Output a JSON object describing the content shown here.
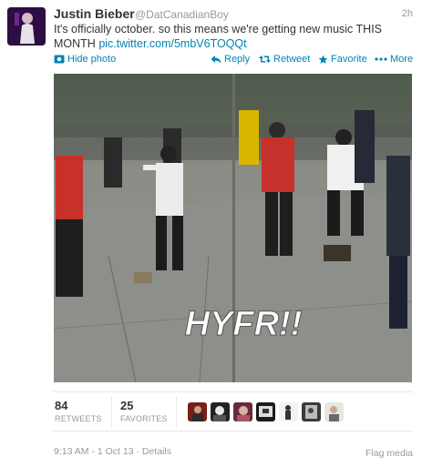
{
  "tweet": {
    "name": "Justin Bieber",
    "handle": "@DatCanadianBoy",
    "time": "2h",
    "text_plain": "It's officially october. so this means we're getting new music THIS MONTH",
    "text_link": "pic.twitter.com/5mbV6TOQQt",
    "photo_caption": "HYFR!!"
  },
  "actions": {
    "hide_photo": "Hide photo",
    "reply": "Reply",
    "retweet": "Retweet",
    "favorite": "Favorite",
    "more": "More"
  },
  "stats": {
    "retweets_count": "84",
    "retweets_label": "RETWEETS",
    "favorites_count": "25",
    "favorites_label": "FAVORITES"
  },
  "footer": {
    "timestamp": "9:13 AM - 1 Oct 13",
    "details": "Details",
    "flag_media": "Flag media"
  },
  "colors": {
    "link": "#0084b4",
    "muted": "#999999",
    "text": "#333333"
  },
  "icons": [
    "photo-icon",
    "reply-icon",
    "retweet-icon",
    "favorite-star-icon",
    "more-dots-icon"
  ]
}
